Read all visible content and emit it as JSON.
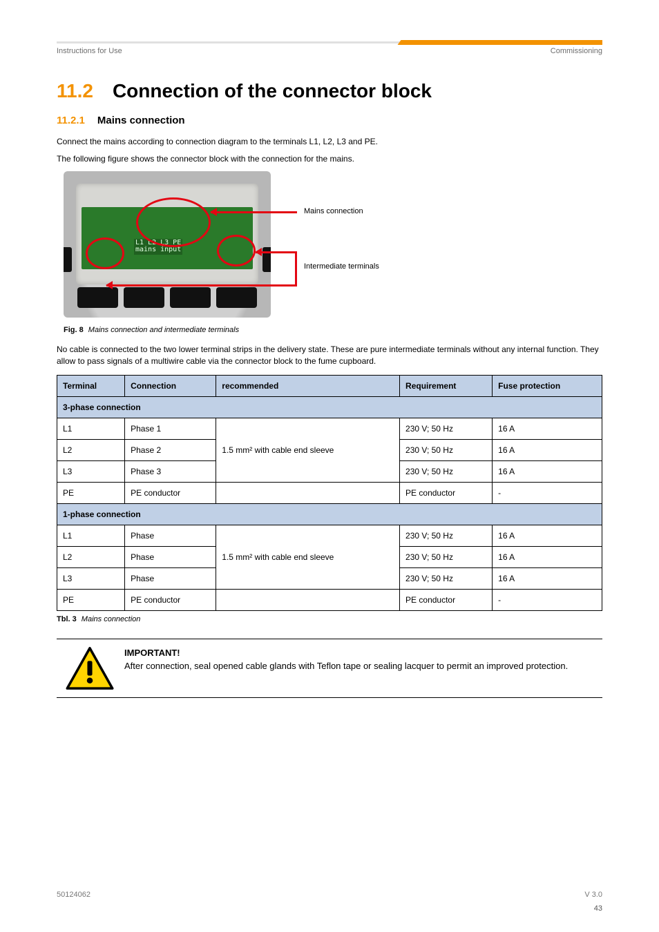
{
  "header": {
    "left": "Instructions for Use",
    "right": "Commissioning"
  },
  "section": {
    "number": "11.2",
    "title": "Connection of the connector block"
  },
  "subsection": {
    "number": "11.2.1",
    "title": "Mains connection"
  },
  "p1": "Connect the mains according to connection diagram  to the terminals L1, L2, L3 and PE.",
  "p2": "The following figure shows the connector block with the connection for the mains.",
  "figure": {
    "pcb_line1": "L1 L2 L3 PE",
    "pcb_line2": "mains input",
    "callout_top": "Mains connection",
    "callout_bottom": "Intermediate terminals",
    "caption_num": "Fig. 8",
    "caption_txt": "Mains connection and intermediate terminals"
  },
  "p3": "No cable is connected to the two lower terminal strips in the delivery state. These are pure intermediate terminals without any internal function. They allow to pass signals of a multiwire cable via the connector block to the fume cupboard.",
  "table": {
    "headers": [
      "Terminal",
      "Connection",
      "recommended",
      "Requirement",
      "Fuse protection"
    ],
    "group1": "3-phase connection",
    "rows1": [
      {
        "t": "L1",
        "c": "Phase 1",
        "r": "1.5 mm² with cable end sleeve",
        "q": "230 V; 50 Hz",
        "f": "16 A"
      },
      {
        "t": "L2",
        "c": "Phase 2",
        "r": "",
        "q": "230 V; 50 Hz",
        "f": "16 A"
      },
      {
        "t": "L3",
        "c": "Phase 3",
        "r": "",
        "q": "230 V; 50 Hz",
        "f": "16 A"
      },
      {
        "t": "PE",
        "c": "PE conductor",
        "r": "",
        "q": "PE conductor",
        "f": "-"
      }
    ],
    "group2": "1-phase connection",
    "rows2": [
      {
        "t": "L1",
        "c": "Phase",
        "r": "1.5 mm² with cable end sleeve",
        "q": "230 V; 50 Hz",
        "f": "16 A"
      },
      {
        "t": "L2",
        "c": "Phase",
        "r": "",
        "q": "230 V; 50 Hz",
        "f": "16 A"
      },
      {
        "t": "L3",
        "c": "Phase",
        "r": "",
        "q": "230 V; 50 Hz",
        "f": "16 A"
      },
      {
        "t": "PE",
        "c": "PE conductor",
        "r": "",
        "q": "PE conductor",
        "f": "-"
      }
    ],
    "caption_num": "Tbl. 3",
    "caption_txt": "Mains connection"
  },
  "note": {
    "bold": "IMPORTANT!",
    "text": "After connection, seal opened cable glands with Teflon tape or sealing lacquer to permit an improved protection."
  },
  "footer": {
    "doc": "50124062",
    "version": "V 3.0",
    "page": "43"
  }
}
